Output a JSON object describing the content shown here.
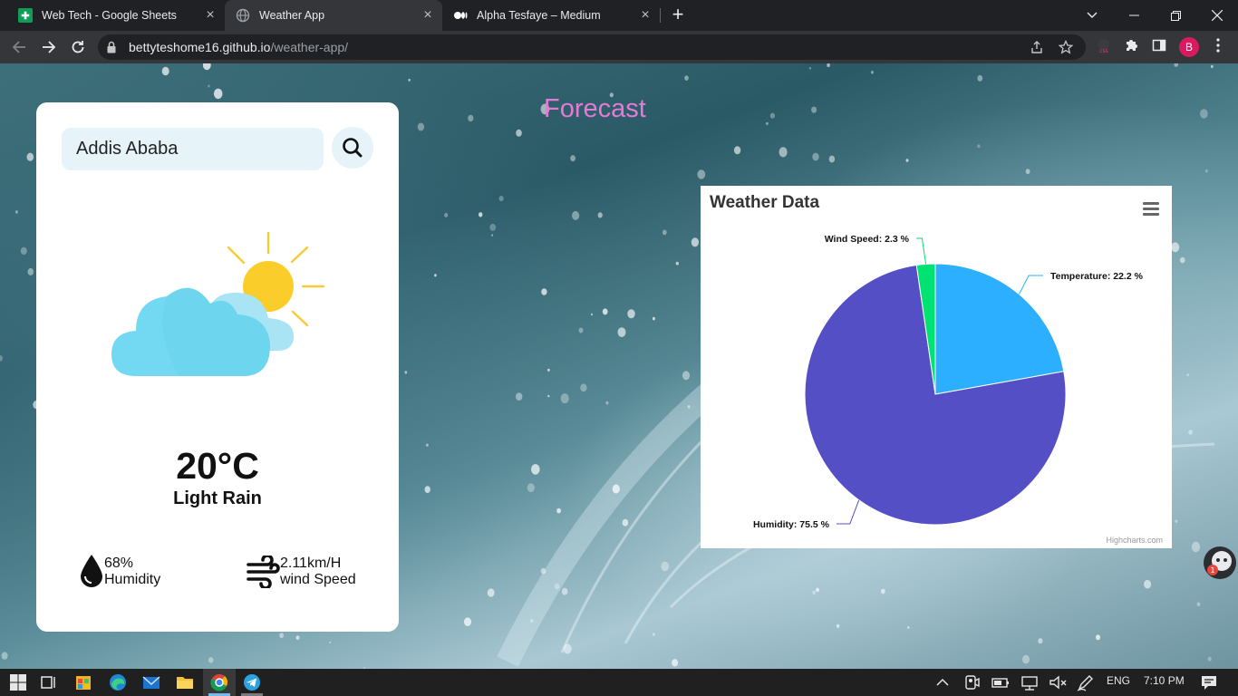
{
  "browser": {
    "tabs": [
      {
        "title": "Web Tech - Google Sheets",
        "favicon": "sheets-icon",
        "active": false
      },
      {
        "title": "Weather App",
        "favicon": "globe-icon",
        "active": true
      },
      {
        "title": "Alpha Tesfaye – Medium",
        "favicon": "medium-icon",
        "active": false
      }
    ],
    "url_host": "bettyteshome16.github.io",
    "url_path": "/weather-app/",
    "profile_initial": "B"
  },
  "page": {
    "forecast_title": "Forecast",
    "search": {
      "value": "Addis Ababa"
    },
    "weather": {
      "temperature": "20°C",
      "description": "Light Rain",
      "icon": "partly-cloudy-icon"
    },
    "humidity": {
      "value": "68%",
      "label": "Humidity"
    },
    "wind": {
      "value": "2.11km/H",
      "label": "wind Speed"
    }
  },
  "chart_data": {
    "type": "pie",
    "title": "Weather Data",
    "credit": "Highcharts.com",
    "slices": [
      {
        "name": "Temperature",
        "value": 22.2,
        "label": "Temperature: 22.2 %",
        "color": "#2caffe"
      },
      {
        "name": "Humidity",
        "value": 75.5,
        "label": "Humidity: 75.5 %",
        "color": "#544fc5"
      },
      {
        "name": "Wind Speed",
        "value": 2.3,
        "label": "Wind Speed: 2.3 %",
        "color": "#00e272"
      }
    ]
  },
  "taskbar": {
    "language": "ENG",
    "time": "7:10 PM"
  }
}
